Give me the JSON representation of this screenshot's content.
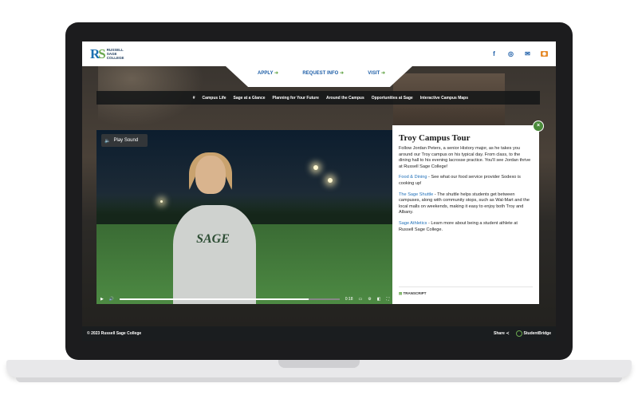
{
  "brand": {
    "logo_mark_a": "R",
    "logo_mark_b": "S",
    "logo_text": "RUSSELL SAGE COLLEGE"
  },
  "social": {
    "icons": [
      "facebook-icon",
      "instagram-icon",
      "email-icon",
      "rss-icon"
    ]
  },
  "cta": {
    "apply": "APPLY",
    "request": "REQUEST INFO",
    "visit": "VISIT"
  },
  "nav": {
    "items": [
      "#",
      "Campus Life",
      "Sage at a Glance",
      "Planning for Your Future",
      "Around the Campus",
      "Opportunities at Sage",
      "Interactive Campus Maps"
    ]
  },
  "video": {
    "sound_label": "Play Sound",
    "time": "0:18",
    "jersey_text": "SAGE",
    "progress": 0.86
  },
  "panel": {
    "title": "Troy Campus Tour",
    "intro": "Follow Jordan Peters, a senior History major, as he takes you around our Troy campus on his typical day. From class, to the dining hall to his evening lacrosse practice. You'll see Jordan thrive at Russell Sage College!",
    "link1": "Food & Dining",
    "text1": " - See what our food service provider Sodexo is cooking up!",
    "link2": "The Sage Shuttle",
    "text2": " - The shuttle helps students get between campuses, along with community stops, such as Wal-Mart and the local malls on weekends, making it easy to enjoy both Troy and Albany.",
    "link3": "Sage Athletics",
    "text3": " - Learn more about being a student athlete at Russell Sage College.",
    "transcript": "TRANSCRIPT",
    "close": "×"
  },
  "footer": {
    "copyright": "© 2023 Russell Sage College",
    "share": "Share",
    "partner": "StudentBridge"
  }
}
